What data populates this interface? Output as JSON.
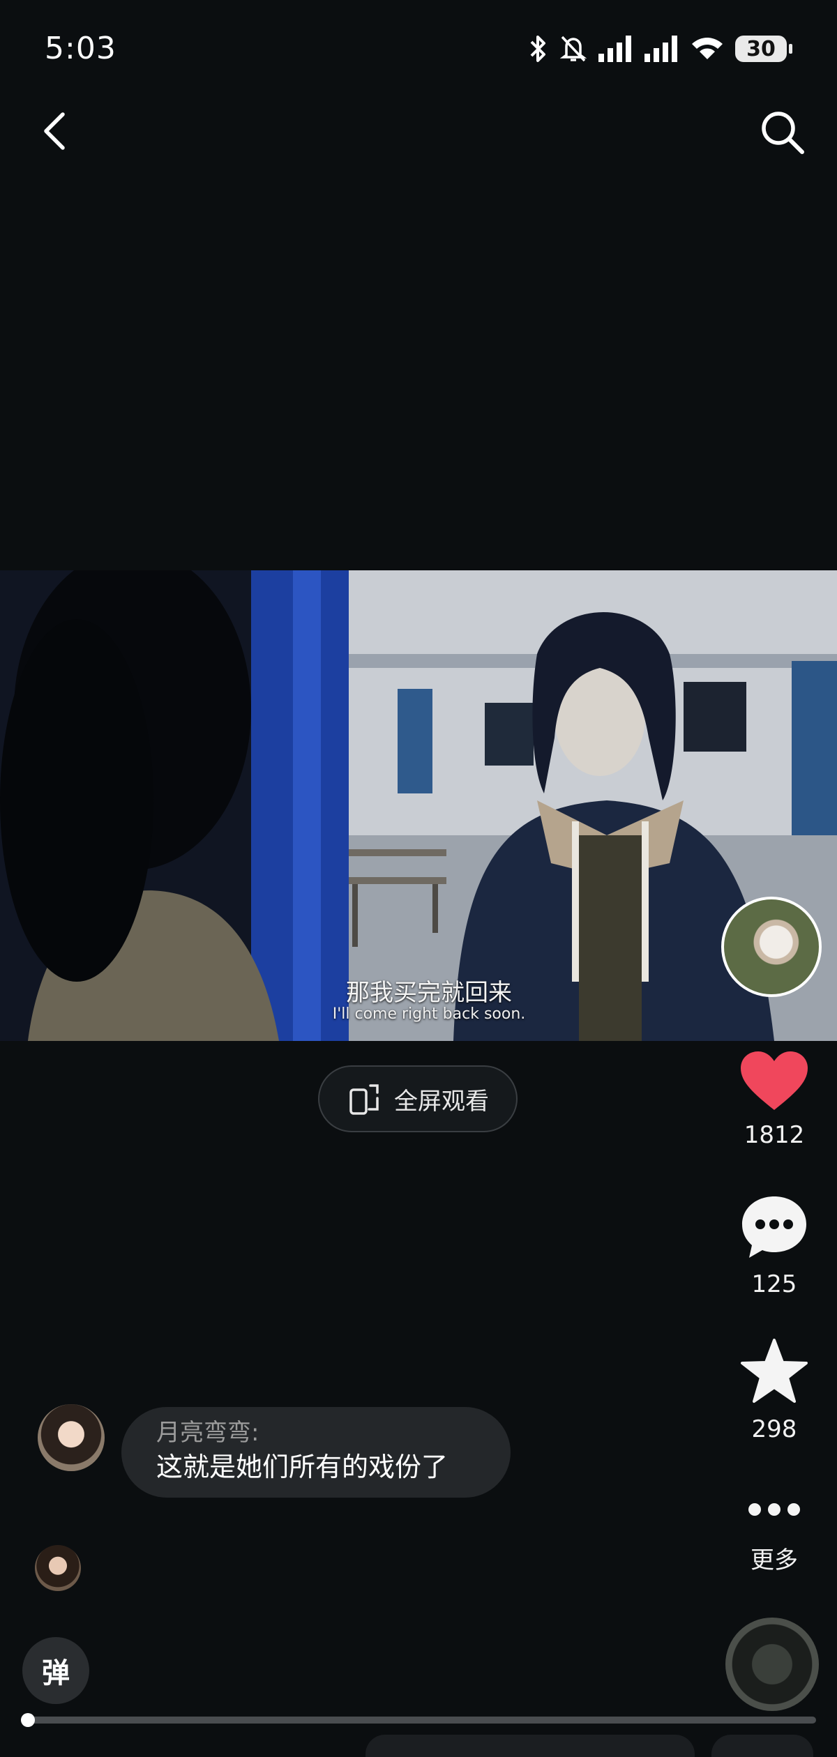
{
  "status_bar": {
    "time": "5:03",
    "battery": "30",
    "icons": [
      "bluetooth-icon",
      "mute-bell-icon",
      "signal-icon",
      "signal-icon",
      "wifi-icon",
      "battery-icon"
    ]
  },
  "nav": {
    "back_icon": "chevron-left-icon",
    "search_icon": "search-icon"
  },
  "video": {
    "subtitle_cn": "那我买完就回来",
    "subtitle_en": "I'll come right back soon.",
    "progress": 0.0
  },
  "fullscreen": {
    "label": "全屏观看",
    "icon": "rotate-screen-icon"
  },
  "actions": {
    "like": {
      "icon": "heart-icon",
      "count": "1812",
      "color": "#f0475c"
    },
    "comment": {
      "icon": "chat-bubble-icon",
      "count": "125"
    },
    "favorite": {
      "icon": "star-icon",
      "count": "298"
    },
    "more": {
      "icon": "more-dots-icon",
      "label": "更多"
    }
  },
  "comment": {
    "author": "月亮弯弯:",
    "text": "这就是她们所有的戏份了"
  },
  "danmaku": {
    "label": "弹"
  }
}
